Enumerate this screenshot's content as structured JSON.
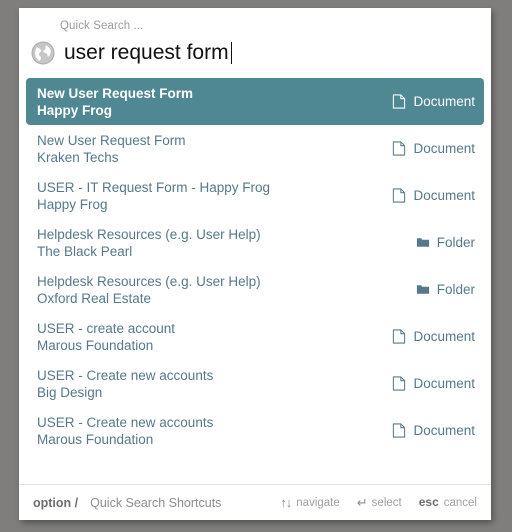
{
  "window": {
    "background_color": "#807e7d",
    "panel_color": "#ffffff",
    "accent_color": "#4f8792",
    "text_color": "#55798a"
  },
  "search": {
    "caption": "Quick Search ...",
    "icon": "globe-icon",
    "value": "user request form",
    "placeholder": "Quick Search ..."
  },
  "results": [
    {
      "title": "New User Request Form",
      "subtitle": "Happy Frog",
      "type": "Document",
      "icon": "document-icon",
      "selected": true
    },
    {
      "title": "New User Request Form",
      "subtitle": "Kraken Techs",
      "type": "Document",
      "icon": "document-icon",
      "selected": false
    },
    {
      "title": "USER - IT Request Form - Happy Frog",
      "subtitle": "Happy Frog",
      "type": "Document",
      "icon": "document-icon",
      "selected": false
    },
    {
      "title": "Helpdesk Resources (e.g. User Help)",
      "subtitle": "The Black Pearl",
      "type": "Folder",
      "icon": "folder-icon",
      "selected": false
    },
    {
      "title": "Helpdesk Resources (e.g. User Help)",
      "subtitle": "Oxford Real Estate",
      "type": "Folder",
      "icon": "folder-icon",
      "selected": false
    },
    {
      "title": "USER - create account",
      "subtitle": "Marous Foundation",
      "type": "Document",
      "icon": "document-icon",
      "selected": false
    },
    {
      "title": "USER - Create new accounts",
      "subtitle": "Big Design",
      "type": "Document",
      "icon": "document-icon",
      "selected": false
    },
    {
      "title": "USER - Create new accounts",
      "subtitle": "Marous Foundation",
      "type": "Document",
      "icon": "document-icon",
      "selected": false
    }
  ],
  "footer": {
    "option_key": "option /",
    "caption": "Quick Search Shortcuts",
    "shortcuts": [
      {
        "glyph": "↑↓",
        "label": "navigate",
        "bold": false
      },
      {
        "glyph": "↵",
        "label": "select",
        "bold": false
      },
      {
        "glyph": "esc",
        "label": "cancel",
        "bold": true
      }
    ]
  }
}
